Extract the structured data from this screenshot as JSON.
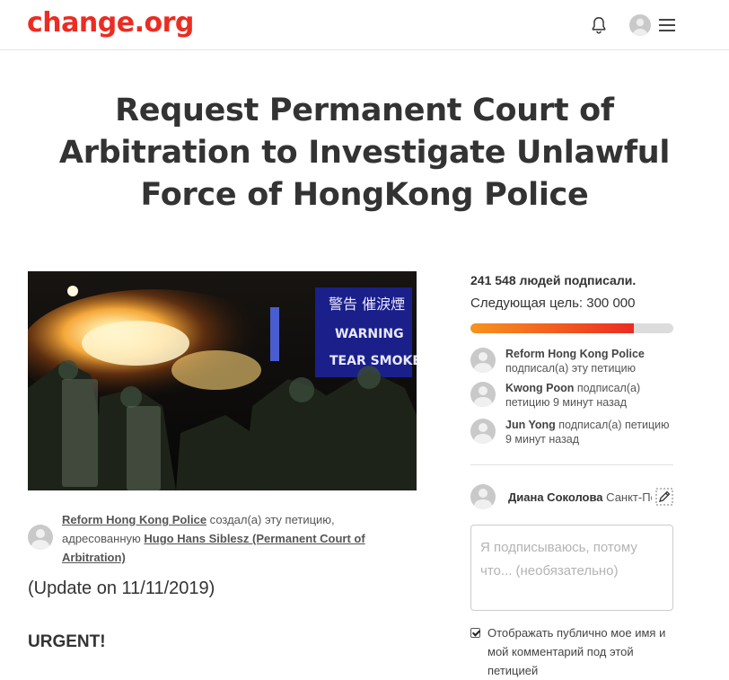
{
  "header": {
    "logo": "change.org",
    "icons": [
      "bell-icon",
      "user-avatar",
      "menu-icon"
    ]
  },
  "petition": {
    "title": "Request Permanent Court of Arbitration to Investigate Unlawful Force of HongKong Police",
    "image": {
      "sign_text": [
        "警告 催淚煙",
        "WARNING",
        "TEAR SMOKE"
      ]
    },
    "creator": {
      "name": "Reform Hong Kong Police",
      "created_text": " создал(а) эту петицию, адресованную ",
      "target": "Hugo Hans Siblesz (Permanent Court of Arbitration)"
    },
    "update": "(Update on 11/11/2019)",
    "urgent": "URGENT!"
  },
  "sidebar": {
    "signed_count": "241 548 людей подписали.",
    "next_goal": "Следующая цель: 300 000",
    "progress": 0.805,
    "colors": {
      "progress_start": "#f7931e",
      "progress_end": "#ec2c22",
      "brand": "#ec2c22"
    },
    "signers": [
      {
        "name": "Reform Hong Kong Police",
        "action": "подписал(а) эту петицию"
      },
      {
        "name": "Kwong Poon",
        "action": " подписал(а) петицию 9 минут назад"
      },
      {
        "name": "Jun Yong",
        "action": " подписал(а) петицию 9 минут назад"
      }
    ],
    "current_user": {
      "name": "Диана Соколова",
      "location": " Санкт-Петербург"
    },
    "comment_placeholder": "Я подписываюсь, потому что... (необязательно)",
    "public_checkbox": {
      "checked": true,
      "label": "Отображать публично мое имя и мой комментарий под этой петицией"
    }
  }
}
